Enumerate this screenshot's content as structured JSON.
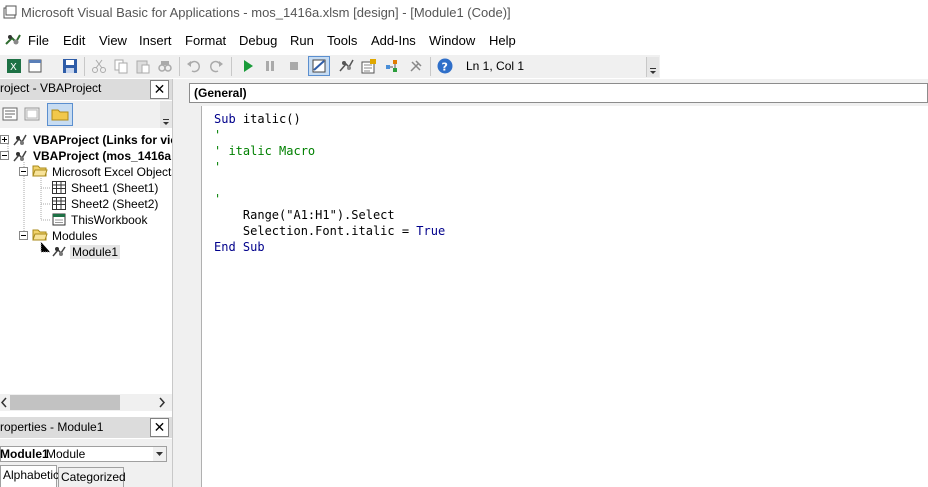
{
  "window": {
    "title": "Microsoft Visual Basic for Applications - mos_1416a.xlsm [design] - [Module1 (Code)]"
  },
  "menu": [
    {
      "label": "File"
    },
    {
      "label": "Edit"
    },
    {
      "label": "View"
    },
    {
      "label": "Insert"
    },
    {
      "label": "Format"
    },
    {
      "label": "Debug"
    },
    {
      "label": "Run"
    },
    {
      "label": "Tools"
    },
    {
      "label": "Add-Ins"
    },
    {
      "label": "Window"
    },
    {
      "label": "Help"
    }
  ],
  "toolbar": {
    "status": "Ln 1, Col 1",
    "icons": [
      "excel-view-icon",
      "insert-userform-icon",
      "save-icon",
      "cut-icon",
      "copy-icon",
      "paste-icon",
      "find-icon",
      "undo-icon",
      "redo-icon",
      "run-icon",
      "break-icon",
      "reset-icon",
      "design-mode-icon",
      "project-explorer-icon",
      "properties-window-icon",
      "object-browser-icon",
      "toolbox-icon",
      "help-icon"
    ]
  },
  "project_pane": {
    "title": "roject - VBAProject",
    "close": "✕",
    "tree": {
      "project1": "VBAProject (Links for vic",
      "project2": "VBAProject (mos_1416a",
      "excel_objects": "Microsoft Excel Objects",
      "sheet1": "Sheet1 (Sheet1)",
      "sheet2": "Sheet2 (Sheet2)",
      "workbook": "ThisWorkbook",
      "modules": "Modules",
      "module1": "Module1"
    }
  },
  "properties_pane": {
    "title": "roperties - Module1",
    "close": "✕",
    "object_name": "Module1",
    "object_type": "Module",
    "tabs": [
      "Alphabetic",
      "Categorized"
    ]
  },
  "code": {
    "object_combo": "(General)",
    "lines": {
      "l1_kw": "Sub",
      "l1_rest": " italic()",
      "l2": "'",
      "l3": "' italic Macro",
      "l4": "'",
      "l5": "",
      "l6": "'",
      "l7": "    Range(\"A1:H1\").Select",
      "l8_pre": "    Selection.Font.italic = ",
      "l8_kw": "True",
      "l9": "End Sub"
    }
  },
  "colors": {
    "keyword": "#00008b",
    "comment": "#008000",
    "pane_header": "#dcdcdc"
  }
}
